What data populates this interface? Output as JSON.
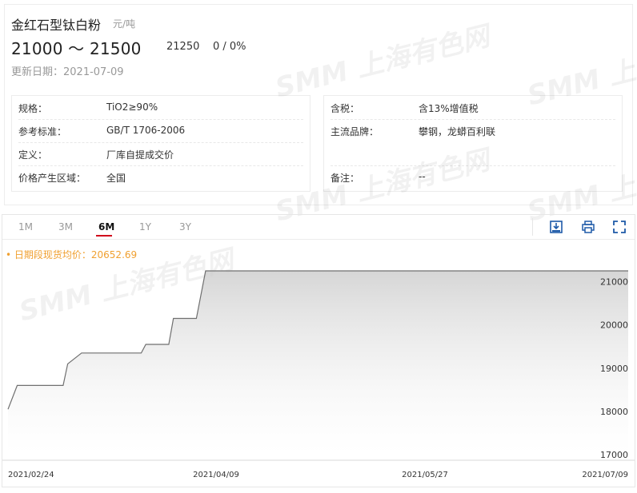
{
  "product": {
    "name": "金红石型钛白粉",
    "unit": "元/吨",
    "price_range": "21000 ～ 21500",
    "average": "21250",
    "change": "0 / 0%",
    "updated": "更新日期：2021-07-09"
  },
  "specs_left": [
    {
      "label": "规格：",
      "value": "TiO2≥90%"
    },
    {
      "label": "参考标准：",
      "value": "GB/T 1706-2006"
    },
    {
      "label": "定义：",
      "value": "厂库自提成交价"
    },
    {
      "label": "价格产生区域：",
      "value": "全国"
    }
  ],
  "specs_right": [
    {
      "label": "含税：",
      "value": "含13%增值税"
    },
    {
      "label": "主流品牌：",
      "value": "攀钢，龙蟒百利联"
    },
    {
      "label": "",
      "value": ""
    },
    {
      "label": "备注：",
      "value": "--"
    }
  ],
  "tabs": [
    {
      "label": "1M",
      "active": false
    },
    {
      "label": "3M",
      "active": false
    },
    {
      "label": "6M",
      "active": true
    },
    {
      "label": "1Y",
      "active": false
    },
    {
      "label": "3Y",
      "active": false
    }
  ],
  "toolbar": {
    "download_icon": "download-image-icon",
    "print_icon": "print-icon",
    "fullscreen_icon": "fullscreen-icon"
  },
  "watermark": "SMM 上海有色网",
  "colors": {
    "accent": "#d0021b",
    "legend": "#f0a030",
    "line": "#6f6f6f"
  },
  "chart_data": {
    "type": "area",
    "legend": "• 日期段现货均价：20652.69",
    "x_labels": [
      "2021/02/24",
      "2021/04/09",
      "2021/05/27",
      "2021/07/09"
    ],
    "y_ticks": [
      17000,
      18000,
      19000,
      20000,
      21000
    ],
    "ylim": [
      17000,
      21250
    ],
    "series": [
      {
        "x": [
          "2021-02-24",
          "2021-02-26",
          "2021-03-01",
          "2021-03-08",
          "2021-03-09",
          "2021-03-12",
          "2021-03-25",
          "2021-03-26",
          "2021-03-31",
          "2021-04-01",
          "2021-04-06",
          "2021-04-08",
          "2021-07-09"
        ],
        "y": [
          18050,
          18600,
          18600,
          18600,
          19100,
          19350,
          19350,
          19550,
          19550,
          20150,
          20150,
          21250,
          21250
        ]
      }
    ],
    "grid": false,
    "y_axis_position": "right"
  }
}
